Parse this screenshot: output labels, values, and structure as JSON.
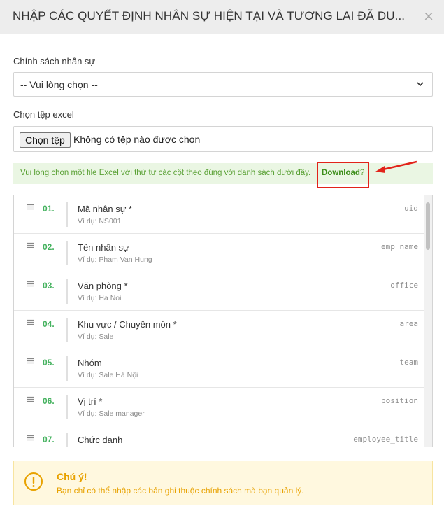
{
  "modal": {
    "title": "NHẬP CÁC QUYẾT ĐỊNH NHÂN SỰ HIỆN TẠI VÀ TƯƠNG LAI ĐÃ DU...",
    "close_glyph": "×"
  },
  "policy": {
    "label": "Chính sách nhân sự",
    "selected": "-- Vui lòng chọn --"
  },
  "file": {
    "label": "Chọn tệp excel",
    "button": "Chọn tệp",
    "status": "Không có tệp nào được chọn"
  },
  "notice": {
    "message": "Vui lòng chọn một file Excel với thứ tự các cột theo đúng với danh sách dưới đây.",
    "link": "Download",
    "suffix": "?"
  },
  "columns": [
    {
      "num": "01.",
      "name": "Mã nhân sự *",
      "example": "Ví dụ: NS001",
      "code": "uid"
    },
    {
      "num": "02.",
      "name": "Tên nhân sự",
      "example": "Ví dụ: Pham Van Hung",
      "code": "emp_name"
    },
    {
      "num": "03.",
      "name": "Văn phòng *",
      "example": "Ví dụ: Ha Noi",
      "code": "office"
    },
    {
      "num": "04.",
      "name": "Khu vực / Chuyên môn *",
      "example": "Ví dụ: Sale",
      "code": "area"
    },
    {
      "num": "05.",
      "name": "Nhóm",
      "example": "Ví dụ: Sale Hà Nội",
      "code": "team"
    },
    {
      "num": "06.",
      "name": "Vị trí *",
      "example": "Ví dụ: Sale manager",
      "code": "position"
    },
    {
      "num": "07.",
      "name": "Chức danh",
      "example": "",
      "code": "employee_title"
    }
  ],
  "warning": {
    "title": "Chú ý!",
    "message": "Bạn chỉ có thể nhập các bản ghi thuộc chính sách mà bạn quản lý."
  },
  "colors": {
    "accent_green": "#45b25f",
    "notice_bg": "#eaf6e3",
    "warning_text": "#e8a200",
    "highlight_red": "#e2231a"
  },
  "icons": {
    "close": "close-icon",
    "select_arrow": "chevron-down-icon",
    "row_handle": "drag-handle-icon",
    "warning": "exclamation-circle-icon",
    "annotation": "arrow-icon"
  }
}
